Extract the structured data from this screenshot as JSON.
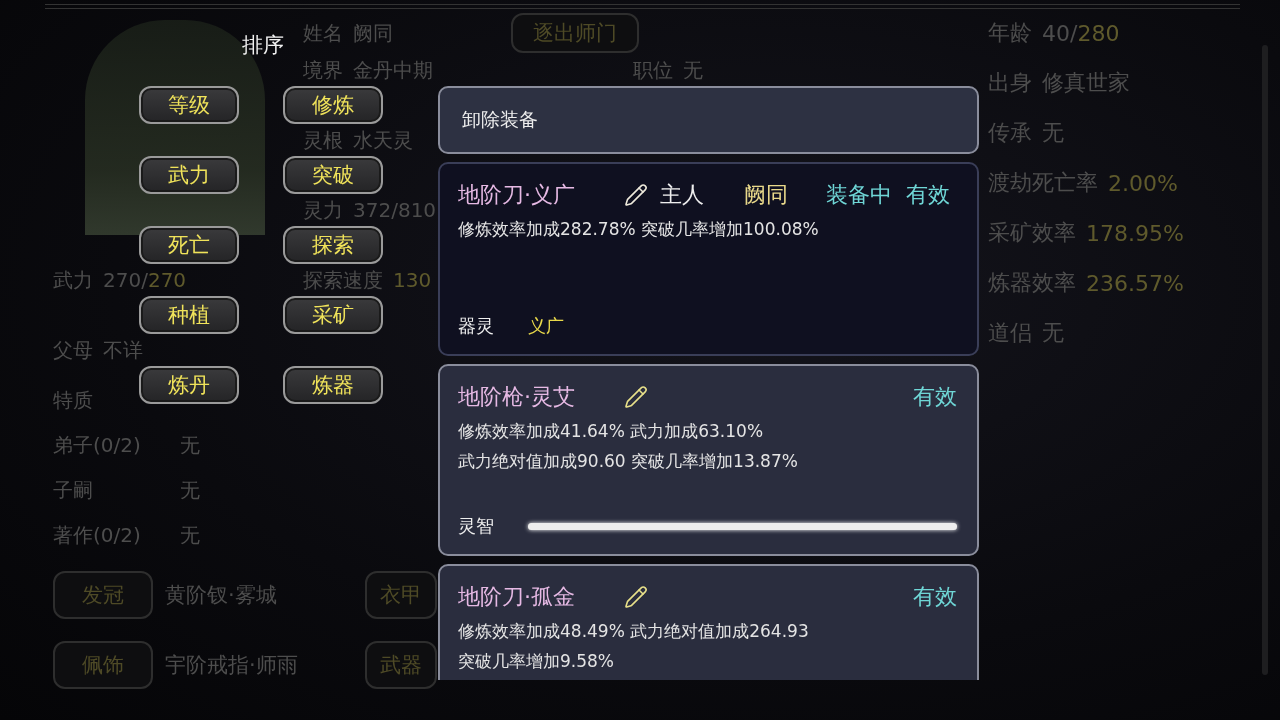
{
  "profile": {
    "top_rows": [
      {
        "label": "姓名",
        "value": "阙同",
        "action": "逐出师门"
      },
      {
        "label": "境界",
        "value": "金丹中期",
        "side_label": "职位",
        "side_value": "无"
      },
      {
        "label": "灵根",
        "value": "水天灵"
      },
      {
        "label": "灵力",
        "value": "372/810"
      },
      {
        "label": "探索速度",
        "value": "",
        "accent": "130"
      }
    ],
    "rows": [
      {
        "label": "武力",
        "value": "270/",
        "accent": "270"
      },
      {
        "label": "父母",
        "value": "不详"
      },
      {
        "label": "特质",
        "value": ""
      },
      {
        "label": "弟子(0/2)",
        "value": "无",
        "kind": "column"
      },
      {
        "label": "子嗣",
        "value": "无",
        "kind": "column"
      },
      {
        "label": "著作(0/2)",
        "value": "无",
        "kind": "column"
      }
    ],
    "equipment": [
      {
        "slot": "发冠",
        "item": "黄阶钗·雾城",
        "slot2": "衣甲"
      },
      {
        "slot": "佩饰",
        "item": "宇阶戒指·师雨",
        "slot2": "武器"
      }
    ],
    "right_rows": [
      {
        "label": "年龄",
        "value": "40/",
        "accent": "280"
      },
      {
        "label": "出身",
        "value": "修真世家"
      },
      {
        "label": "传承",
        "value": "无"
      },
      {
        "label": "渡劫死亡率",
        "value": "",
        "accent": "2.00%"
      },
      {
        "label": "采矿效率",
        "value": "",
        "accent": "178.95%"
      },
      {
        "label": "炼器效率",
        "value": "",
        "accent": "236.57%"
      },
      {
        "label": "道侣",
        "value": "无"
      }
    ]
  },
  "sort_panel": {
    "title": "排序",
    "buttons": [
      "等级",
      "修炼",
      "武力",
      "突破",
      "死亡",
      "探索",
      "种植",
      "采矿",
      "炼丹",
      "炼器"
    ]
  },
  "equip_popup": {
    "unequip": "卸除装备",
    "cards": [
      {
        "name": "地阶刀·义广",
        "equipped": true,
        "owner_label": "主人",
        "owner": "阙同",
        "status": "装备中",
        "validity": "有效",
        "effects": [
          "修炼效率加成282.78% 突破几率增加100.08%"
        ],
        "footer": {
          "kind": "spirit",
          "label": "器灵",
          "value": "义广"
        }
      },
      {
        "name": "地阶枪·灵艾",
        "equipped": false,
        "validity": "有效",
        "effects": [
          "修炼效率加成41.64% 武力加成63.10%",
          "武力绝对值加成90.60 突破几率增加13.87%"
        ],
        "footer": {
          "kind": "wisdom",
          "label": "灵智",
          "level": 1
        }
      },
      {
        "name": "地阶刀·孤金",
        "equipped": false,
        "validity": "有效",
        "effects": [
          "修炼效率加成48.49% 武力绝对值加成264.93",
          "突破几率增加9.58%"
        ]
      }
    ]
  }
}
